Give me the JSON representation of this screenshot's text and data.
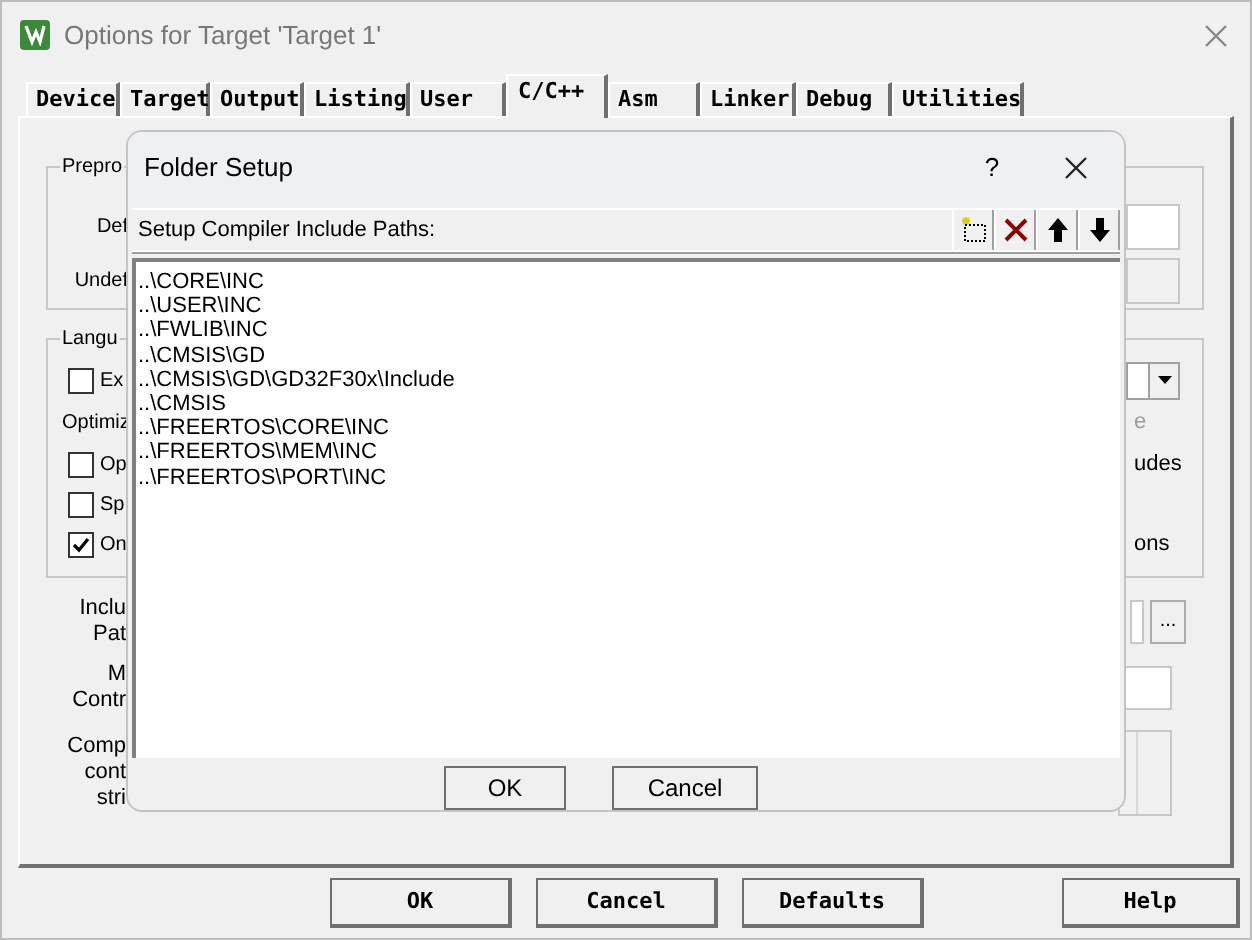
{
  "window": {
    "title": "Options for Target 'Target 1'"
  },
  "tabs": [
    {
      "label": "Device",
      "selected": false
    },
    {
      "label": "Target",
      "selected": false
    },
    {
      "label": "Output",
      "selected": false
    },
    {
      "label": "Listing",
      "selected": false
    },
    {
      "label": "User",
      "selected": false
    },
    {
      "label": "C/C++",
      "selected": true
    },
    {
      "label": "Asm",
      "selected": false
    },
    {
      "label": "Linker",
      "selected": false
    },
    {
      "label": "Debug",
      "selected": false
    },
    {
      "label": "Utilities",
      "selected": false
    }
  ],
  "preprocessor_group": {
    "label": "Prepro",
    "define_label": "Def",
    "undefine_label": "Undef"
  },
  "language_group": {
    "label": "Langu",
    "optimization_label": "Optimiz",
    "greyed_text": "e",
    "checkboxes": [
      {
        "label": "Ex",
        "checked": false
      },
      {
        "label": "Op",
        "checked": false,
        "right_text": "udes"
      },
      {
        "label": "Sp",
        "checked": false
      },
      {
        "label": "On",
        "checked": true,
        "right_text": "ons"
      }
    ]
  },
  "include_paths_label": [
    "Inclu",
    "Pat"
  ],
  "browse_button": "...",
  "misc_controls_label": [
    "M",
    "Contr"
  ],
  "compiler_string_label": [
    "Comp",
    "cont",
    "stri"
  ],
  "buttons": [
    "OK",
    "Cancel",
    "Defaults",
    "Help"
  ],
  "folder_setup": {
    "title": "Folder Setup",
    "help": "?",
    "list_header": "Setup Compiler Include Paths:",
    "paths": [
      "..\\CORE\\INC",
      "..\\USER\\INC",
      "..\\FWLIB\\INC",
      "..\\CMSIS\\GD",
      "..\\CMSIS\\GD\\GD32F30x\\Include",
      "..\\CMSIS",
      "..\\FREERTOS\\CORE\\INC",
      "..\\FREERTOS\\MEM\\INC",
      "..\\FREERTOS\\PORT\\INC"
    ],
    "buttons": [
      "OK",
      "Cancel"
    ]
  }
}
